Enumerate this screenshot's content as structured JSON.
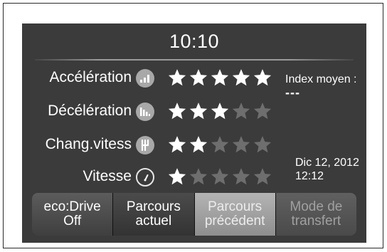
{
  "time": "10:10",
  "metrics": [
    {
      "label": "Accélération",
      "icon": "acceleration-bars-icon",
      "rating": 5,
      "max": 5
    },
    {
      "label": "Décélération",
      "icon": "deceleration-bars-icon",
      "rating": 3,
      "max": 5
    },
    {
      "label": "Chang.vitess",
      "icon": "gearshift-icon",
      "rating": 2,
      "max": 5
    },
    {
      "label": "Vitesse",
      "icon": "speedometer-icon",
      "rating": 1,
      "max": 5
    }
  ],
  "index": {
    "label": "Index moyen :",
    "value": "---"
  },
  "date": {
    "line1": "Dic 12, 2012",
    "line2": "12:12"
  },
  "tabs": [
    {
      "line1": "eco:Drive",
      "line2": "Off"
    },
    {
      "line1": "Parcours",
      "line2": "actuel"
    },
    {
      "line1": "Parcours",
      "line2": "précédent",
      "selected": true
    },
    {
      "line1": "Mode de",
      "line2": "transfert",
      "disabled": true
    }
  ],
  "colors": {
    "screen": "#3b3b3b",
    "star_active": "#ffffff",
    "star_inactive": "#6e6e6e",
    "badge": "#a8a8a8"
  }
}
